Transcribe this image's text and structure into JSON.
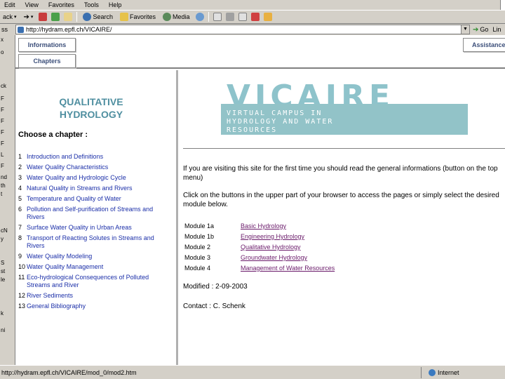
{
  "browser": {
    "menu": [
      "Edit",
      "View",
      "Favorites",
      "Tools",
      "Help"
    ],
    "toolbar": {
      "back_label": "ack",
      "search_label": "Search",
      "favorites_label": "Favorites",
      "media_label": "Media"
    },
    "address": {
      "label": "ss",
      "url": "http://hydram.epfl.ch/VICAIRE/",
      "go_label": "Go",
      "links_label": "Lin"
    },
    "left_strip": [
      "x",
      "o",
      "ck",
      "F",
      "F",
      "F",
      "F",
      "F",
      "L",
      "F",
      "nd",
      "th",
      "t",
      "cN",
      "y",
      "S",
      "st",
      "le",
      "k",
      "ni"
    ],
    "status": {
      "text": "http://hydram.epfl.ch/VICAIRE/mod_0/mod2.htm",
      "zone": "Internet"
    }
  },
  "site": {
    "nav": {
      "informations": "Informations",
      "chapters": "Chapters",
      "assistance": "Assistance"
    },
    "left": {
      "title_line1": "QUALITATIVE",
      "title_line2": "HYDROLOGY",
      "choose": "Choose a chapter :",
      "chapters": [
        {
          "num": "1",
          "title": "Introduction and Definitions"
        },
        {
          "num": "2",
          "title": "Water Quality Characteristics"
        },
        {
          "num": "3",
          "title": "Water Quality and Hydrologic Cycle"
        },
        {
          "num": "4",
          "title": "Natural Quality in Streams and Rivers"
        },
        {
          "num": "5",
          "title": "Temperature and Quality of Water"
        },
        {
          "num": "6",
          "title": "Pollution and Self-purification of Streams and Rivers"
        },
        {
          "num": "7",
          "title": "Surface Water Quality in Urban Areas"
        },
        {
          "num": "8",
          "title": "Transport of Reacting Solutes in Streams and Rivers"
        },
        {
          "num": "9",
          "title": "Water Quality Modeling"
        },
        {
          "num": "10",
          "title": "Water Quality Management"
        },
        {
          "num": "11",
          "title": "Eco-hydrological Consequences of Polluted Streams and River"
        },
        {
          "num": "12",
          "title": "River Sediments"
        },
        {
          "num": "13",
          "title": "General Bibliography"
        }
      ]
    },
    "right": {
      "logo_word": "VICAIRE",
      "logo_line1": "VIRTUAL CAMPUS IN",
      "logo_line2": "HYDROLOGY AND WATER",
      "logo_line3": "RESOURCES",
      "para1": "If you are visiting this site for the first time you should read the general informations (button on the top menu)",
      "para2": "Click on the buttons in the upper part of your browser to access the pages or simply select the desired module below.",
      "modules": [
        {
          "name": "Module 1a",
          "link": "Basic Hydrology"
        },
        {
          "name": "Module 1b",
          "link": "Engineering Hydrology"
        },
        {
          "name": "Module 2",
          "link": "Qualitative Hydrology"
        },
        {
          "name": "Module 3",
          "link": "Groundwater Hydrology"
        },
        {
          "name": "Module 4",
          "link": "Management of Water Resources"
        }
      ],
      "modified": "Modified : 2-09-2003",
      "contact": "Contact : C. Schenk"
    }
  }
}
